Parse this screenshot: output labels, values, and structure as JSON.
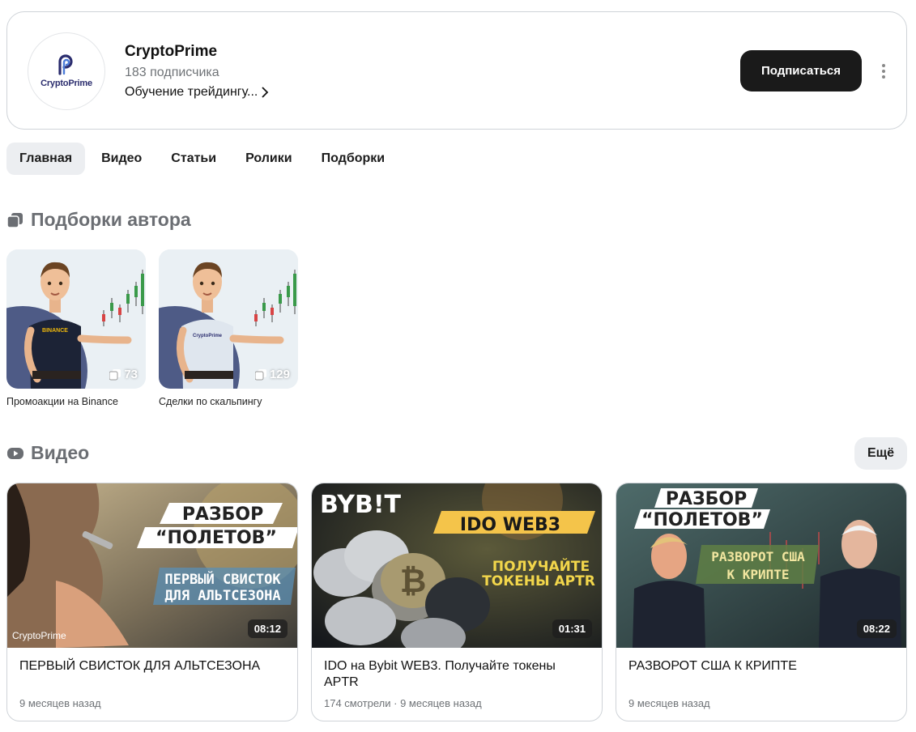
{
  "channel": {
    "avatar_text": "CryptoPrime",
    "name": "CryptoPrime",
    "subscribers": "183 подписчика",
    "description": "Обучение трейдингу...",
    "subscribe_label": "Подписаться"
  },
  "tabs": [
    {
      "label": "Главная",
      "active": true
    },
    {
      "label": "Видео"
    },
    {
      "label": "Статьи"
    },
    {
      "label": "Ролики"
    },
    {
      "label": "Подборки"
    }
  ],
  "collections_section": {
    "title": "Подборки автора",
    "items": [
      {
        "label": "Промоакции на Binance",
        "count": "73",
        "shirt_text": "BINANCE"
      },
      {
        "label": "Сделки по скальпингу",
        "count": "129",
        "shirt_text": "CryptoPrime"
      }
    ]
  },
  "videos_section": {
    "title": "Видео",
    "more_label": "Ещё",
    "items": [
      {
        "title": "ПЕРВЫЙ СВИСТОК ДЛЯ АЛЬТСЕЗОНА",
        "meta": "9 месяцев назад",
        "duration": "08:12",
        "thumb_lines": [
          "РАЗБОР",
          "“ПОЛЕТОВ”",
          "ПЕРВЫЙ СВИСТОК",
          "ДЛЯ АЛЬТСЕЗОНА"
        ],
        "thumb_logo": "CryptoPrime"
      },
      {
        "title": "IDO на Bybit WEB3. Получайте токены APTR",
        "meta": "174 смотрели · 9 месяцев назад",
        "duration": "01:31",
        "thumb_lines": [
          "BYB!T",
          "IDO WEB3",
          "ПОЛУЧАЙТЕ",
          "ТОКЕНЫ APTR"
        ]
      },
      {
        "title": "РАЗВОРОТ США К КРИПТЕ",
        "meta": "9 месяцев назад",
        "duration": "08:22",
        "thumb_lines": [
          "РАЗБОР",
          "“ПОЛЕТОВ”",
          "РАЗВОРОТ США",
          "К КРИПТЕ"
        ]
      }
    ]
  }
}
